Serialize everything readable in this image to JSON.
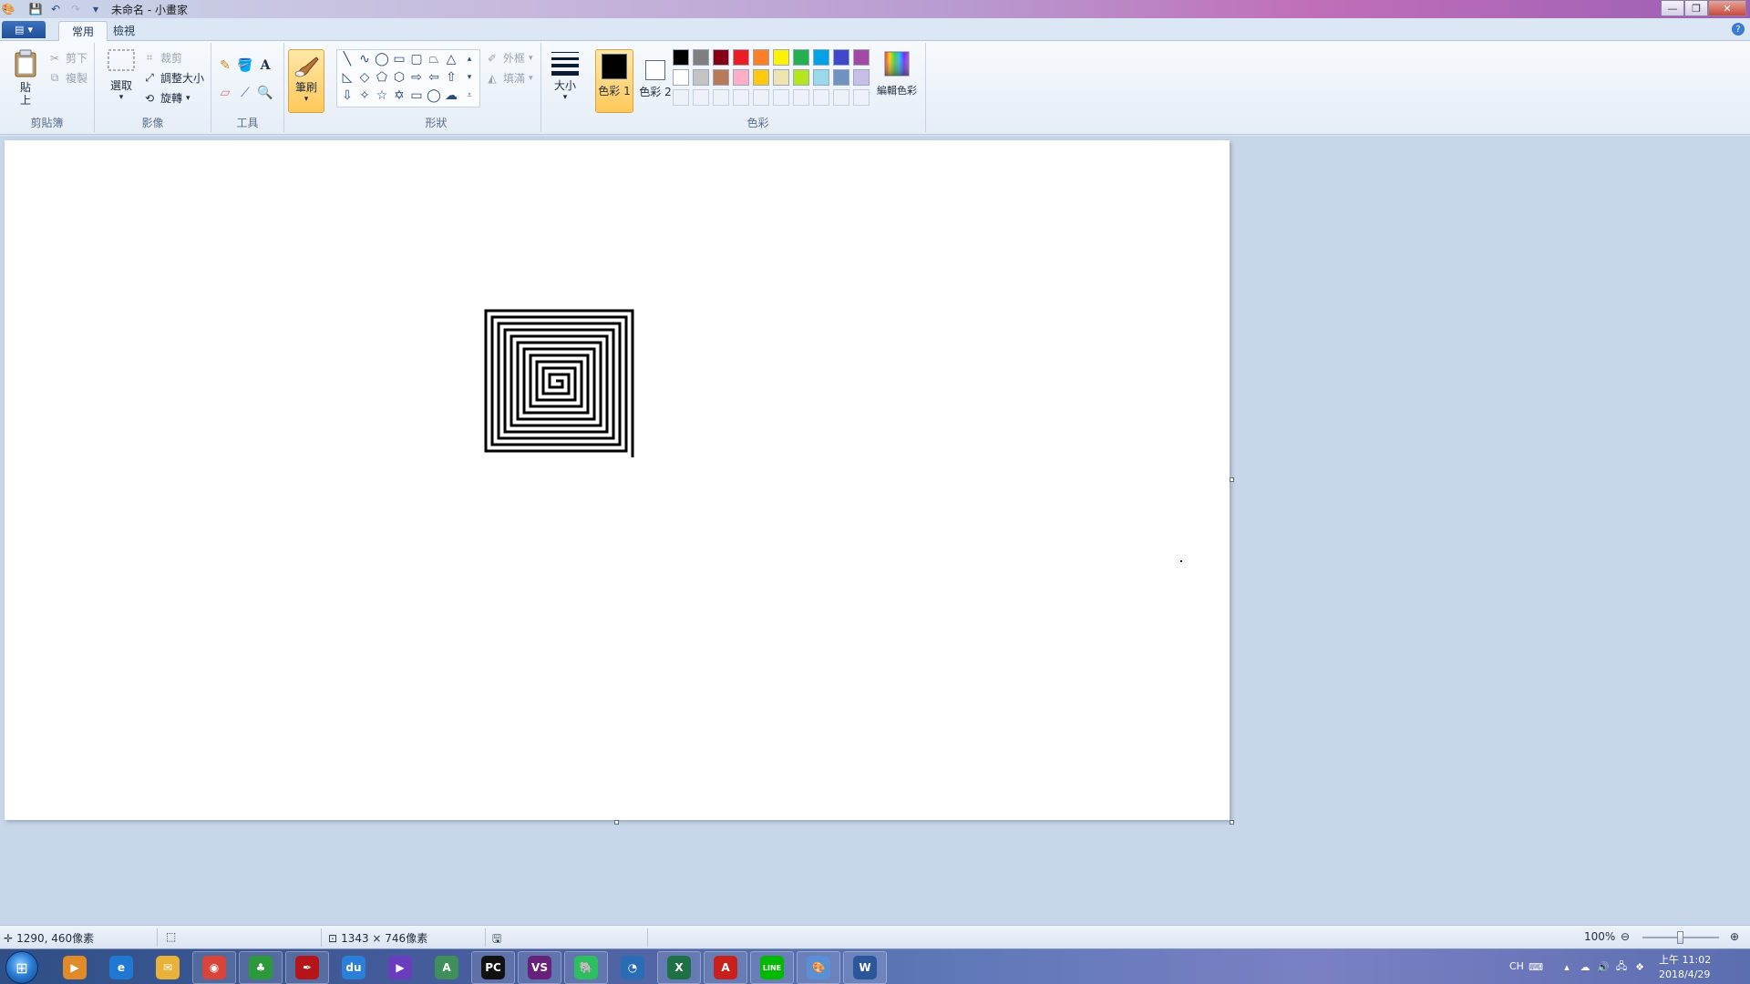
{
  "window": {
    "title": "未命名 - 小畫家"
  },
  "tabs": {
    "home": "常用",
    "view": "檢視"
  },
  "ribbon": {
    "clipboard": {
      "label": "剪貼簿",
      "paste": "貼上",
      "cut": "剪下",
      "copy": "複製"
    },
    "image": {
      "label": "影像",
      "select": "選取",
      "crop": "裁剪",
      "resize": "調整大小",
      "rotate": "旋轉"
    },
    "tools": {
      "label": "工具"
    },
    "brushes": {
      "label": "筆刷"
    },
    "shapes": {
      "label": "形狀",
      "outline": "外框",
      "fill": "填滿"
    },
    "size": {
      "label": "大小"
    },
    "colors": {
      "label": "色彩",
      "color1": "色彩 1",
      "color2": "色彩 2",
      "edit": "編輯色彩",
      "color1_value": "#000000",
      "color2_value": "#ffffff",
      "palette_row1": [
        "#000000",
        "#7f7f7f",
        "#880015",
        "#ed1c24",
        "#ff7f27",
        "#fff200",
        "#22b14c",
        "#00a2e8",
        "#3f48cc",
        "#a349a4"
      ],
      "palette_row2": [
        "#ffffff",
        "#c3c3c3",
        "#b97a57",
        "#ffaec9",
        "#ffc90e",
        "#efe4b0",
        "#b5e61d",
        "#99d9ea",
        "#7092be",
        "#c8bfe7"
      ]
    }
  },
  "status": {
    "cursor_pos": "1290, 460像素",
    "canvas_size": "1343 × 746像素",
    "zoom": "100%"
  },
  "taskbar": {
    "apps": [
      "start",
      "media-player",
      "internet-explorer",
      "outlook",
      "chrome",
      "clover",
      "adobe-reader",
      "baidu-cloud",
      "visual-studio-purple",
      "android-studio",
      "pycharm",
      "visual-studio",
      "evernote",
      "media-center",
      "excel",
      "acrobat",
      "line",
      "paint",
      "word"
    ],
    "ime": "CH",
    "time": "上午 11:02",
    "date": "2018/4/29"
  }
}
